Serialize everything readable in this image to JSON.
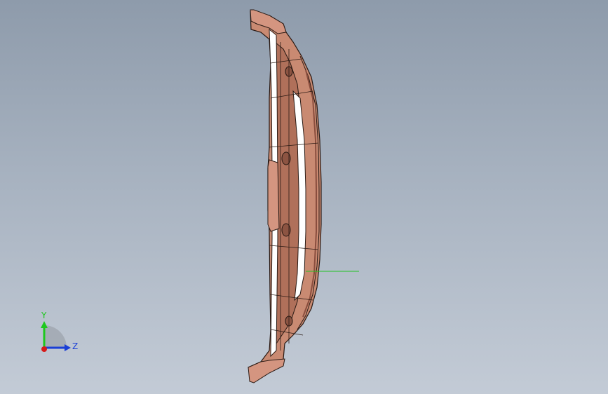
{
  "scene": {
    "part_color": "#c98a72",
    "part_shadow": "#a86a55",
    "edge_color": "#2a1a14",
    "highlight_color": "#ffffff",
    "normal_line_color": "#22c322"
  },
  "triad": {
    "y_label": "Y",
    "z_label": "Z",
    "y_color": "#1ec81e",
    "z_color": "#1a3fd6",
    "x_color": "#d61a1a"
  }
}
